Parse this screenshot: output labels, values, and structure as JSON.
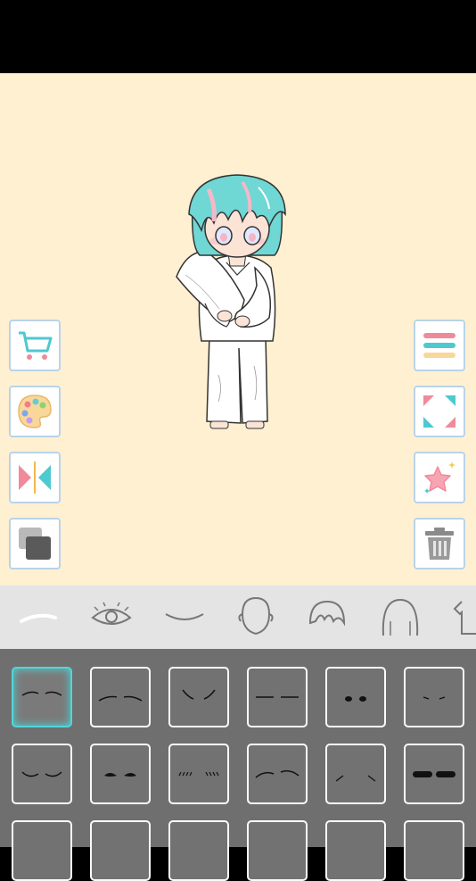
{
  "colors": {
    "canvas_bg": "#fff0d2",
    "hair": "#6fd7d4",
    "hair_highlight": "#f5b8c8",
    "button_border": "#b9d3e8",
    "selected_border": "#4fd6da",
    "panel_bg": "#6f6f6f",
    "tabbar_bg": "#e4e4e4"
  },
  "left_toolbar": [
    {
      "name": "cart-button",
      "icon": "shopping-cart-icon"
    },
    {
      "name": "palette-button",
      "icon": "color-palette-icon"
    },
    {
      "name": "flip-button",
      "icon": "flip-horizontal-icon"
    },
    {
      "name": "layers-button",
      "icon": "layers-icon"
    }
  ],
  "right_toolbar": [
    {
      "name": "menu-button",
      "icon": "menu-icon"
    },
    {
      "name": "fullscreen-button",
      "icon": "expand-icon"
    },
    {
      "name": "favorites-button",
      "icon": "star-icon"
    },
    {
      "name": "delete-button",
      "icon": "trash-icon"
    }
  ],
  "category_tabs": [
    {
      "name": "eyebrows",
      "icon": "eyebrow-icon",
      "selected": true
    },
    {
      "name": "eyes",
      "icon": "eye-icon",
      "selected": false
    },
    {
      "name": "mouth",
      "icon": "mouth-icon",
      "selected": false
    },
    {
      "name": "face",
      "icon": "face-icon",
      "selected": false
    },
    {
      "name": "front-hair",
      "icon": "bangs-icon",
      "selected": false
    },
    {
      "name": "back-hair",
      "icon": "hair-icon",
      "selected": false
    },
    {
      "name": "clothes",
      "icon": "shirt-icon",
      "selected": false
    }
  ],
  "eyebrow_options": {
    "selected_index": 0,
    "visible_rows": 3
  }
}
